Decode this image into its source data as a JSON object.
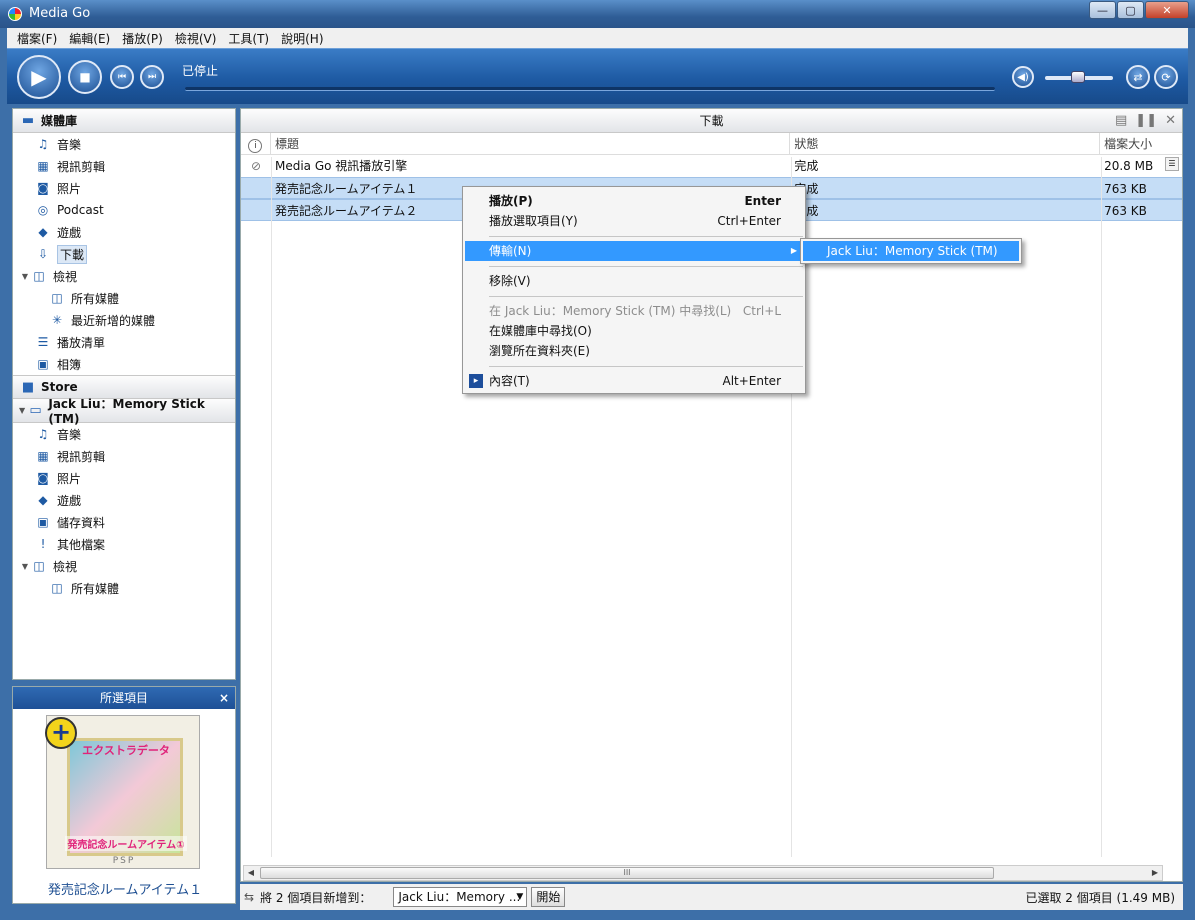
{
  "window": {
    "title": "Media Go"
  },
  "menubar": [
    "檔案(F)",
    "編輯(E)",
    "播放(P)",
    "檢視(V)",
    "工具(T)",
    "說明(H)"
  ],
  "transport": {
    "status": "已停止",
    "play_icon": "▶",
    "stop_icon": "■",
    "prev_icon": "⏮",
    "next_icon": "⏭"
  },
  "library": {
    "header": "媒體庫",
    "items": [
      {
        "label": "音樂",
        "icon": "♫"
      },
      {
        "label": "視訊剪輯",
        "icon": "▦"
      },
      {
        "label": "照片",
        "icon": "◙"
      },
      {
        "label": "Podcast",
        "icon": "◎"
      },
      {
        "label": "遊戲",
        "icon": "◆"
      },
      {
        "label": "下載",
        "icon": "⇩"
      },
      {
        "label": "檢視",
        "icon": "◫"
      },
      {
        "label": "所有媒體",
        "icon": "◫"
      },
      {
        "label": "最近新增的媒體",
        "icon": "✳"
      },
      {
        "label": "播放清單",
        "icon": "☰"
      },
      {
        "label": "相簿",
        "icon": "▣"
      }
    ]
  },
  "store": {
    "header": "Store"
  },
  "device": {
    "header": "Jack Liu：Memory Stick (TM)",
    "items": [
      {
        "label": "音樂",
        "icon": "♫"
      },
      {
        "label": "視訊剪輯",
        "icon": "▦"
      },
      {
        "label": "照片",
        "icon": "◙"
      },
      {
        "label": "遊戲",
        "icon": "◆"
      },
      {
        "label": "儲存資料",
        "icon": "▣"
      },
      {
        "label": "其他檔案",
        "icon": "!"
      },
      {
        "label": "檢視",
        "icon": "◫"
      },
      {
        "label": "所有媒體",
        "icon": "◫"
      }
    ]
  },
  "selected_panel": {
    "header": "所選項目",
    "close": "×",
    "cover_title": "エクストラデータ",
    "cover_sub": "発売記念ルームアイテム①",
    "cover_brand": "PSP",
    "caption": "発売記念ルームアイテム１"
  },
  "main": {
    "title": "下載",
    "columns": {
      "info": "i",
      "title": "標題",
      "status": "狀態",
      "size": "檔案大小"
    },
    "rows": [
      {
        "title": "Media Go 視訊播放引擎",
        "status": "完成",
        "size": "20.8 MB"
      },
      {
        "title": "発売記念ルームアイテム１",
        "status": "完成",
        "size": "763 KB"
      },
      {
        "title": "発売記念ルームアイテム２",
        "status": "完成",
        "size": "763 KB"
      }
    ],
    "scroll_grip": "III"
  },
  "bottombar": {
    "add_label": "將 2 個項目新增到：",
    "target": "Jack Liu：Memory ...",
    "start": "開始",
    "selection": "已選取 2 個項目 (1.49 MB)"
  },
  "context_menu": {
    "play": {
      "label": "播放(P)",
      "shortcut": "Enter"
    },
    "play_selected": {
      "label": "播放選取項目(Y)",
      "shortcut": "Ctrl+Enter"
    },
    "transfer": {
      "label": "傳輸(N)"
    },
    "remove": {
      "label": "移除(V)"
    },
    "find_device": {
      "label": "在 Jack Liu：Memory Stick (TM) 中尋找(L)",
      "shortcut": "Ctrl+L"
    },
    "find_library": {
      "label": "在媒體庫中尋找(O)"
    },
    "browse_folder": {
      "label": "瀏覽所在資料夾(E)"
    },
    "properties": {
      "label": "內容(T)",
      "shortcut": "Alt+Enter"
    }
  },
  "submenu": {
    "device": "Jack Liu：Memory Stick (TM)"
  }
}
